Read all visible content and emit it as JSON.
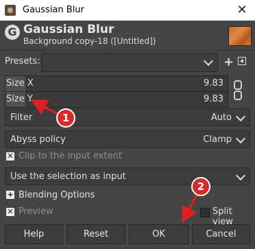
{
  "window": {
    "title": "Gaussian Blur",
    "close_glyph": "✕"
  },
  "header": {
    "title": "Gaussian Blur",
    "subtitle": "Background copy-18 ([Untitled])",
    "logo_letter": "G"
  },
  "presets": {
    "label": "Presets:",
    "value": ""
  },
  "size_x": {
    "label": "Size",
    "axis": "X",
    "value": "9.83"
  },
  "size_y": {
    "label": "Size",
    "axis": "Y",
    "value": "9.83"
  },
  "filter": {
    "label": "Filter",
    "value": "Auto"
  },
  "abyss": {
    "label": "Abyss policy",
    "value": "Clamp"
  },
  "clip": {
    "label": "Clip to the input extent",
    "checked": true
  },
  "selection": {
    "label": "Use the selection as input"
  },
  "blending": {
    "label": "Blending Options"
  },
  "preview": {
    "label": "Preview",
    "checked": true
  },
  "split": {
    "label": "Split view",
    "checked": false
  },
  "buttons": {
    "help": "Help",
    "reset": "Reset",
    "ok": "OK",
    "cancel": "Cancel"
  },
  "annotations": {
    "badge1": "1",
    "badge2": "2"
  },
  "colors": {
    "dialog_bg": "#454545",
    "badge": "#d92a2a",
    "arrow": "#e02020"
  }
}
